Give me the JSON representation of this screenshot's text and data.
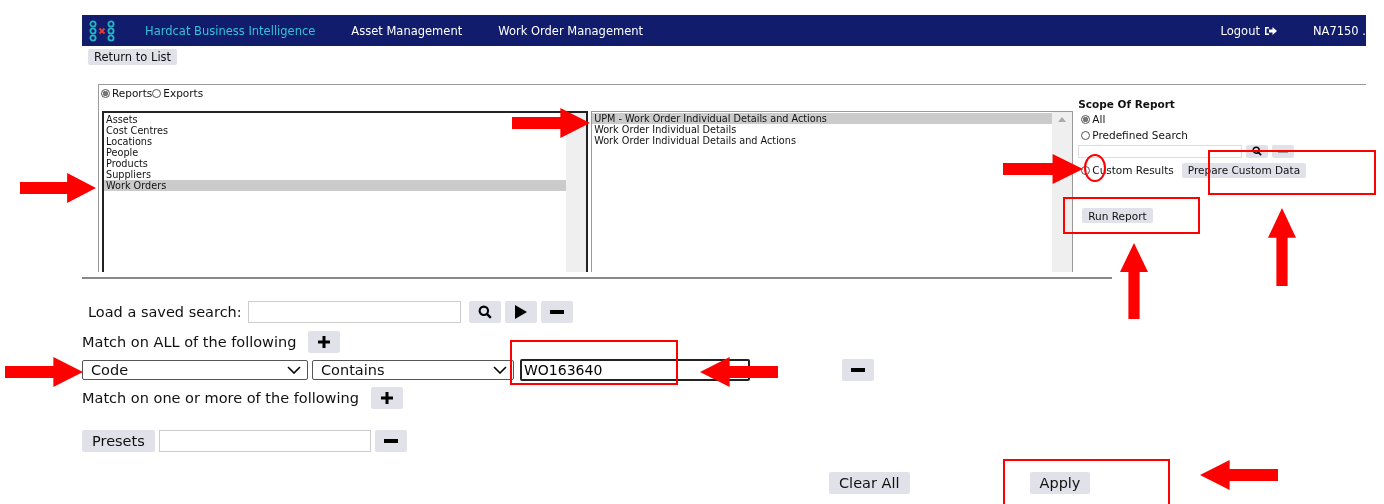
{
  "header": {
    "app_title": "Hardcat Business Intelligence",
    "nav": [
      "Asset Management",
      "Work Order Management"
    ],
    "logout": "Logout",
    "user": "NA7150 ."
  },
  "return_button": "Return to List",
  "mode_options": [
    {
      "label": "Reports",
      "selected": true
    },
    {
      "label": "Exports",
      "selected": false
    }
  ],
  "categories": [
    {
      "label": "Assets",
      "selected": false
    },
    {
      "label": "Cost Centres",
      "selected": false
    },
    {
      "label": "Locations",
      "selected": false
    },
    {
      "label": "People",
      "selected": false
    },
    {
      "label": "Products",
      "selected": false
    },
    {
      "label": "Suppliers",
      "selected": false
    },
    {
      "label": "Work Orders",
      "selected": true
    }
  ],
  "reports": [
    {
      "label": "UPM - Work Order Individual Details and Actions",
      "selected": true
    },
    {
      "label": "Work Order Individual Details",
      "selected": false
    },
    {
      "label": "Work Order Individual Details and Actions",
      "selected": false
    }
  ],
  "scope": {
    "title": "Scope Of Report",
    "options": [
      {
        "label": "All",
        "selected": true,
        "kind": "plain"
      },
      {
        "label": "Predefined Search",
        "selected": false,
        "kind": "search"
      },
      {
        "label": "Custom Results",
        "selected": false,
        "kind": "custom",
        "button": "Prepare Custom Data"
      }
    ],
    "run_button": "Run Report"
  },
  "saved_search": {
    "label": "Load a saved search:"
  },
  "match_all": {
    "label": "Match on ALL of the following"
  },
  "conditions": [
    {
      "field": "Code",
      "operator": "Contains",
      "value": "WO163640"
    }
  ],
  "match_any": {
    "label": "Match on one or more of the following"
  },
  "presets": {
    "button": "Presets"
  },
  "actions": [
    "Clear All",
    "Apply"
  ]
}
